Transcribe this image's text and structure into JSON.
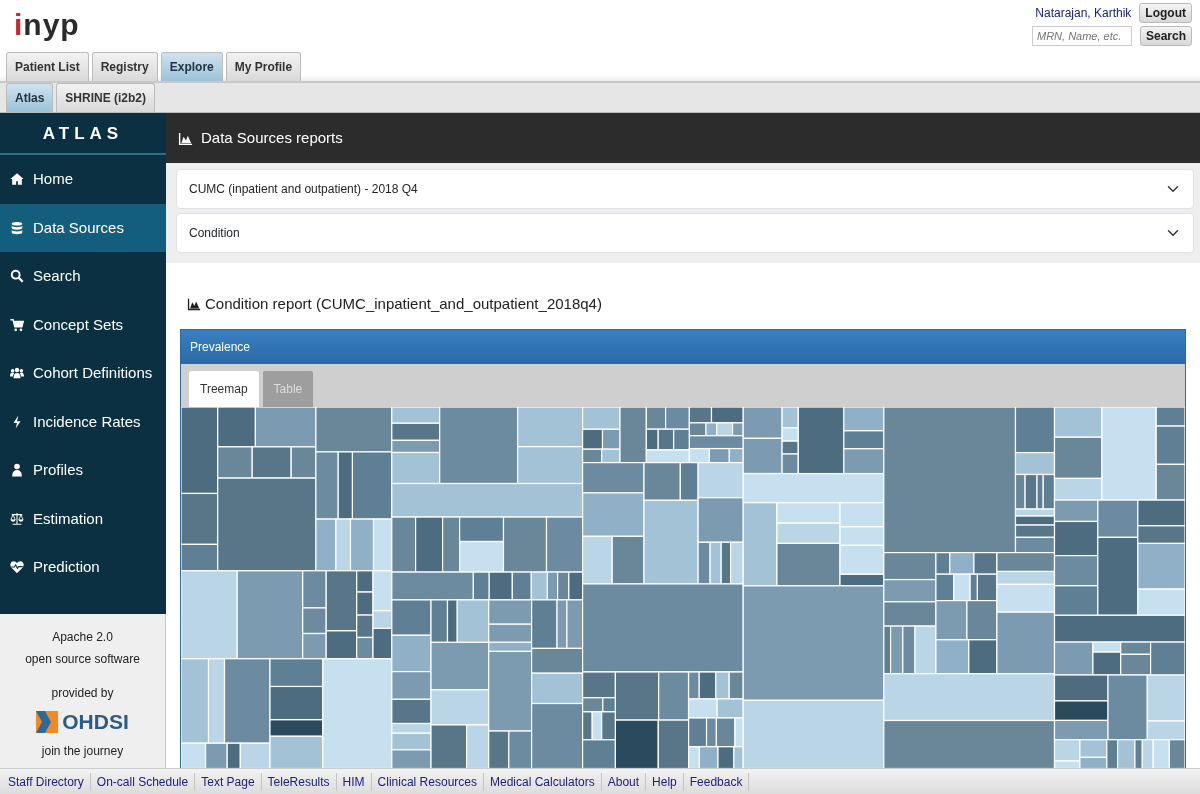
{
  "header": {
    "logo": {
      "accent": "i",
      "rest": "nyp"
    },
    "user_name": "Natarajan, Karthik",
    "logout_button": "Logout",
    "search": {
      "placeholder": "MRN, Name, etc.",
      "button": "Search"
    }
  },
  "main_tabs": [
    {
      "label": "Patient List",
      "selected": false
    },
    {
      "label": "Registry",
      "selected": false
    },
    {
      "label": "Explore",
      "selected": true
    },
    {
      "label": "My Profile",
      "selected": false
    }
  ],
  "sub_tabs": [
    {
      "label": "Atlas",
      "selected": true
    },
    {
      "label": "SHRINE (i2b2)",
      "selected": false
    }
  ],
  "sidebar": {
    "title": "ATLAS",
    "items": [
      {
        "label": "Home",
        "selected": false
      },
      {
        "label": "Data Sources",
        "selected": true
      },
      {
        "label": "Search",
        "selected": false
      },
      {
        "label": "Concept Sets",
        "selected": false
      },
      {
        "label": "Cohort Definitions",
        "selected": false
      },
      {
        "label": "Incidence Rates",
        "selected": false
      },
      {
        "label": "Profiles",
        "selected": false
      },
      {
        "label": "Estimation",
        "selected": false
      },
      {
        "label": "Prediction",
        "selected": false
      }
    ],
    "footer": {
      "license_link": "Apache 2.0",
      "license_text": "open source software",
      "provided_by": "provided by",
      "org_name": "OHDSI",
      "join_link": "join the journey"
    }
  },
  "page_title": "Data Sources reports",
  "source_select": "CUMC (inpatient and outpatient) - 2018 Q4",
  "report_select": "Condition",
  "report": {
    "title": "Condition report (CUMC_inpatient_and_outpatient_2018q4)",
    "panel_title": "Prevalence",
    "tabs": [
      {
        "label": "Treemap",
        "selected": true
      },
      {
        "label": "Table",
        "selected": false
      }
    ]
  },
  "footer_links": [
    "Staff Directory",
    "On-call Schedule",
    "Text Page",
    "TeleResults",
    "HIM",
    "Clinical Resources",
    "Medical Calculators",
    "About",
    "Help",
    "Feedback"
  ]
}
